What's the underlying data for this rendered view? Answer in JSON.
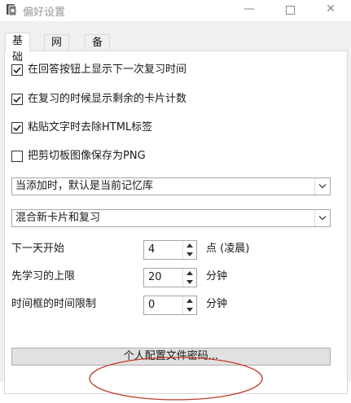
{
  "window": {
    "title": "偏好设置",
    "icon": "app-icon"
  },
  "tabs": [
    {
      "label": "基础",
      "active": true
    },
    {
      "label": "网络",
      "active": false
    },
    {
      "label": "备份",
      "active": false
    }
  ],
  "checkboxes": [
    {
      "label": "在回答按钮上显示下一次复习时间",
      "checked": true
    },
    {
      "label": "在复习的时候显示剩余的卡片计数",
      "checked": true
    },
    {
      "label": "粘贴文字时去除HTML标签",
      "checked": true
    },
    {
      "label": "把剪切板图像保存为PNG",
      "checked": false
    }
  ],
  "combos": [
    {
      "value": "当添加时，默认是当前记忆库"
    },
    {
      "value": "混合新卡片和复习"
    }
  ],
  "spins": [
    {
      "label": "下一天开始",
      "value": "4",
      "unit": "点 (凌晨)"
    },
    {
      "label": "先学习的上限",
      "value": "20",
      "unit": "分钟"
    },
    {
      "label": "时间框的时间限制",
      "value": "0",
      "unit": "分钟"
    }
  ],
  "profile_button": {
    "label": "个人配置文件密码..."
  },
  "colors": {
    "annotation": "#c0392b",
    "checkmark": "#1a1a1a"
  }
}
